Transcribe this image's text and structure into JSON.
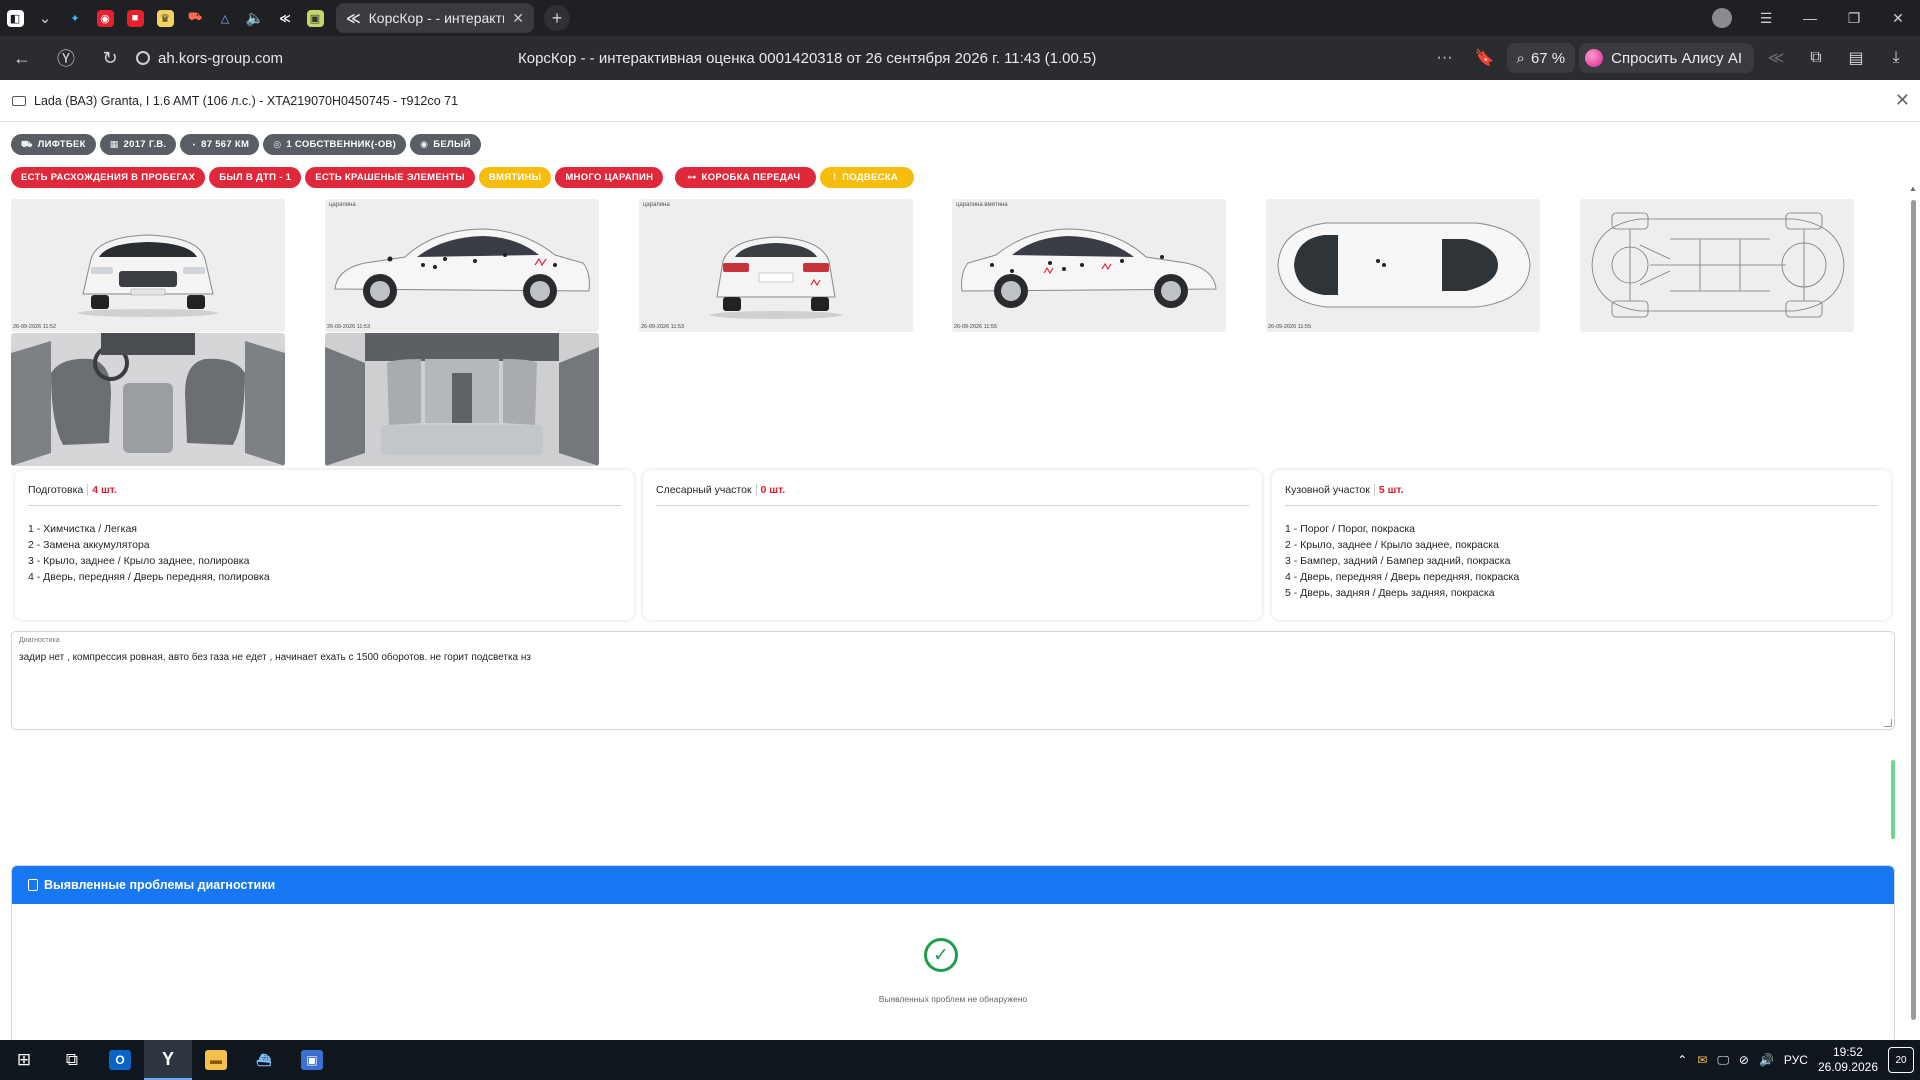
{
  "browser": {
    "active_tab_title": "КорсКор - - интеракти",
    "url": "ah.kors-group.com",
    "page_title": "КорсКор - - интерактивная оценка 0001420318 от 26 сентября 2026 г. 11:43 (1.00.5)",
    "zoom": "67 %",
    "alice_label": "Спросить Алису AI"
  },
  "modal": {
    "title": "Lada (ВАЗ) Granta, I 1.6 AMT (106 л.с.) - XTA219070H0450745 - т912со 71"
  },
  "badges_info": [
    {
      "label": "ЛИФТБЕК",
      "icon": "car-icon"
    },
    {
      "label": "2017 Г.В.",
      "icon": "calendar-icon"
    },
    {
      "label": "87 567 КМ",
      "icon": "speedometer-icon"
    },
    {
      "label": "1 СОБСТВЕННИК(-ОВ)",
      "icon": "owner-icon"
    },
    {
      "label": "БЕЛЫЙ",
      "icon": "eye-icon"
    }
  ],
  "badges_status": [
    {
      "label": "ЕСТЬ РАСХОЖДЕНИЯ В ПРОБЕГАХ",
      "color": "#e0283b"
    },
    {
      "label": "БЫЛ В ДТП - 1",
      "color": "#e0283b"
    },
    {
      "label": "ЕСТЬ КРАШЕНЫЕ ЭЛЕМЕНТЫ",
      "color": "#e0283b"
    },
    {
      "label": "ВМЯТИНЫ",
      "color": "#f7bd0e"
    },
    {
      "label": "МНОГО ЦАРАПИН",
      "color": "#e0283b"
    },
    {
      "label": "КОРОБКА ПЕРЕДАЧ",
      "color": "#e0283b"
    },
    {
      "label": "ПОДВЕСКА",
      "color": "#f7bd0e"
    }
  ],
  "photos": [
    {
      "view": "front",
      "timestamp": "26-09-2026 11:52"
    },
    {
      "view": "left-side",
      "timestamp": "26-09-2026 11:53",
      "tag": "царапина"
    },
    {
      "view": "rear",
      "timestamp": "26-09-2026 11:53",
      "tag": "царапина"
    },
    {
      "view": "right-side",
      "timestamp": "26-09-2026 11:55",
      "tag": "царапина вмятина"
    },
    {
      "view": "top",
      "timestamp": "26-09-2026 11:55"
    },
    {
      "view": "underbody",
      "timestamp": ""
    },
    {
      "view": "interior-front",
      "timestamp": ""
    },
    {
      "view": "interior-rear",
      "timestamp": ""
    }
  ],
  "work_sections": [
    {
      "title": "Подготовка",
      "count": "4 шт.",
      "items": [
        "1 - Химчистка / Легкая",
        "2 - Замена аккумулятора",
        "3 - Крыло, заднее / Крыло заднее, полировка",
        "4 - Дверь, передняя / Дверь передняя, полировка"
      ]
    },
    {
      "title": "Слесарный участок",
      "count": "0 шт.",
      "items": []
    },
    {
      "title": "Кузовной участок",
      "count": "5 шт.",
      "items": [
        "1 - Порог / Порог, покраска",
        "2 - Крыло, заднее / Крыло заднее, покраска",
        "3 - Бампер, задний / Бампер задний, покраска",
        "4 - Дверь, передняя / Дверь передняя, покраска",
        "5 - Дверь, задняя / Дверь задняя, покраска"
      ]
    }
  ],
  "diagnostics": {
    "label": "Диагностика",
    "value": "задир нет , компрессия ровная, авто без газа не едет , начинает ехать с 1500 оборотов. не горит подсветка нз"
  },
  "problems": {
    "title": "Выявленные проблемы диагностики",
    "empty_text": "Выявленных проблем не обнаружено"
  },
  "taskbar": {
    "language": "РУС",
    "time": "19:52",
    "date": "26.09.2026",
    "notifications": "20"
  },
  "colors": {
    "accent": "#1877f2",
    "danger": "#e0283b",
    "warning": "#f7bd0e",
    "success": "#1e9e4a"
  }
}
